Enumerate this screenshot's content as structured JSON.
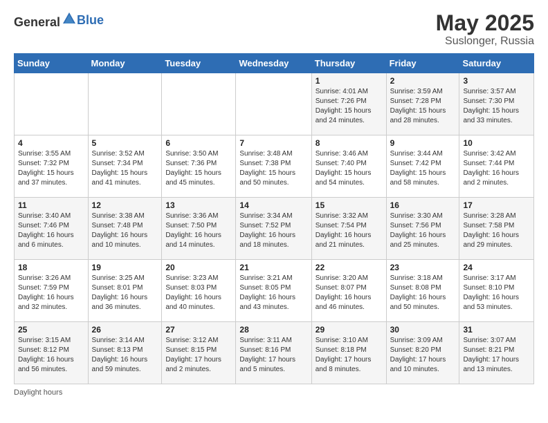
{
  "header": {
    "logo_general": "General",
    "logo_blue": "Blue",
    "title": "May 2025",
    "subtitle": "Suslonger, Russia"
  },
  "footer": {
    "note": "Daylight hours"
  },
  "weekdays": [
    "Sunday",
    "Monday",
    "Tuesday",
    "Wednesday",
    "Thursday",
    "Friday",
    "Saturday"
  ],
  "weeks": [
    [
      {
        "day": "",
        "info": ""
      },
      {
        "day": "",
        "info": ""
      },
      {
        "day": "",
        "info": ""
      },
      {
        "day": "",
        "info": ""
      },
      {
        "day": "1",
        "info": "Sunrise: 4:01 AM\nSunset: 7:26 PM\nDaylight: 15 hours\nand 24 minutes."
      },
      {
        "day": "2",
        "info": "Sunrise: 3:59 AM\nSunset: 7:28 PM\nDaylight: 15 hours\nand 28 minutes."
      },
      {
        "day": "3",
        "info": "Sunrise: 3:57 AM\nSunset: 7:30 PM\nDaylight: 15 hours\nand 33 minutes."
      }
    ],
    [
      {
        "day": "4",
        "info": "Sunrise: 3:55 AM\nSunset: 7:32 PM\nDaylight: 15 hours\nand 37 minutes."
      },
      {
        "day": "5",
        "info": "Sunrise: 3:52 AM\nSunset: 7:34 PM\nDaylight: 15 hours\nand 41 minutes."
      },
      {
        "day": "6",
        "info": "Sunrise: 3:50 AM\nSunset: 7:36 PM\nDaylight: 15 hours\nand 45 minutes."
      },
      {
        "day": "7",
        "info": "Sunrise: 3:48 AM\nSunset: 7:38 PM\nDaylight: 15 hours\nand 50 minutes."
      },
      {
        "day": "8",
        "info": "Sunrise: 3:46 AM\nSunset: 7:40 PM\nDaylight: 15 hours\nand 54 minutes."
      },
      {
        "day": "9",
        "info": "Sunrise: 3:44 AM\nSunset: 7:42 PM\nDaylight: 15 hours\nand 58 minutes."
      },
      {
        "day": "10",
        "info": "Sunrise: 3:42 AM\nSunset: 7:44 PM\nDaylight: 16 hours\nand 2 minutes."
      }
    ],
    [
      {
        "day": "11",
        "info": "Sunrise: 3:40 AM\nSunset: 7:46 PM\nDaylight: 16 hours\nand 6 minutes."
      },
      {
        "day": "12",
        "info": "Sunrise: 3:38 AM\nSunset: 7:48 PM\nDaylight: 16 hours\nand 10 minutes."
      },
      {
        "day": "13",
        "info": "Sunrise: 3:36 AM\nSunset: 7:50 PM\nDaylight: 16 hours\nand 14 minutes."
      },
      {
        "day": "14",
        "info": "Sunrise: 3:34 AM\nSunset: 7:52 PM\nDaylight: 16 hours\nand 18 minutes."
      },
      {
        "day": "15",
        "info": "Sunrise: 3:32 AM\nSunset: 7:54 PM\nDaylight: 16 hours\nand 21 minutes."
      },
      {
        "day": "16",
        "info": "Sunrise: 3:30 AM\nSunset: 7:56 PM\nDaylight: 16 hours\nand 25 minutes."
      },
      {
        "day": "17",
        "info": "Sunrise: 3:28 AM\nSunset: 7:58 PM\nDaylight: 16 hours\nand 29 minutes."
      }
    ],
    [
      {
        "day": "18",
        "info": "Sunrise: 3:26 AM\nSunset: 7:59 PM\nDaylight: 16 hours\nand 32 minutes."
      },
      {
        "day": "19",
        "info": "Sunrise: 3:25 AM\nSunset: 8:01 PM\nDaylight: 16 hours\nand 36 minutes."
      },
      {
        "day": "20",
        "info": "Sunrise: 3:23 AM\nSunset: 8:03 PM\nDaylight: 16 hours\nand 40 minutes."
      },
      {
        "day": "21",
        "info": "Sunrise: 3:21 AM\nSunset: 8:05 PM\nDaylight: 16 hours\nand 43 minutes."
      },
      {
        "day": "22",
        "info": "Sunrise: 3:20 AM\nSunset: 8:07 PM\nDaylight: 16 hours\nand 46 minutes."
      },
      {
        "day": "23",
        "info": "Sunrise: 3:18 AM\nSunset: 8:08 PM\nDaylight: 16 hours\nand 50 minutes."
      },
      {
        "day": "24",
        "info": "Sunrise: 3:17 AM\nSunset: 8:10 PM\nDaylight: 16 hours\nand 53 minutes."
      }
    ],
    [
      {
        "day": "25",
        "info": "Sunrise: 3:15 AM\nSunset: 8:12 PM\nDaylight: 16 hours\nand 56 minutes."
      },
      {
        "day": "26",
        "info": "Sunrise: 3:14 AM\nSunset: 8:13 PM\nDaylight: 16 hours\nand 59 minutes."
      },
      {
        "day": "27",
        "info": "Sunrise: 3:12 AM\nSunset: 8:15 PM\nDaylight: 17 hours\nand 2 minutes."
      },
      {
        "day": "28",
        "info": "Sunrise: 3:11 AM\nSunset: 8:16 PM\nDaylight: 17 hours\nand 5 minutes."
      },
      {
        "day": "29",
        "info": "Sunrise: 3:10 AM\nSunset: 8:18 PM\nDaylight: 17 hours\nand 8 minutes."
      },
      {
        "day": "30",
        "info": "Sunrise: 3:09 AM\nSunset: 8:20 PM\nDaylight: 17 hours\nand 10 minutes."
      },
      {
        "day": "31",
        "info": "Sunrise: 3:07 AM\nSunset: 8:21 PM\nDaylight: 17 hours\nand 13 minutes."
      }
    ]
  ]
}
